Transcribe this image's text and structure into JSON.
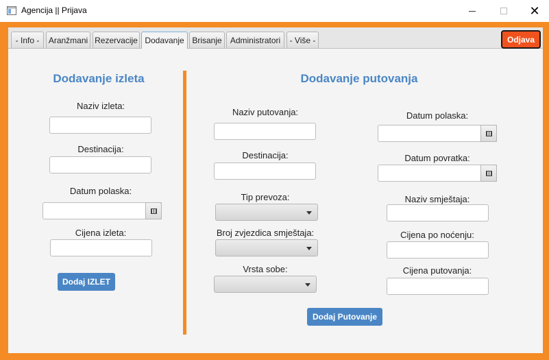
{
  "window": {
    "title": "Agencija || Prijava",
    "minimize_icon": "minimize-icon",
    "maximize_icon": "maximize-icon",
    "close_glyph": "✕"
  },
  "tabs": [
    {
      "label": "- Info -"
    },
    {
      "label": "Aranžmani"
    },
    {
      "label": "Rezervacije"
    },
    {
      "label": "Dodavanje",
      "active": true
    },
    {
      "label": "Brisanje"
    },
    {
      "label": "Administratori"
    },
    {
      "label": "- Više -"
    }
  ],
  "logout_label": "Odjava",
  "izlet": {
    "heading": "Dodavanje izleta",
    "naziv_label": "Naziv izleta:",
    "destinacija_label": "Destinacija:",
    "datum_label": "Datum polaska:",
    "cijena_label": "Cijena izleta:",
    "button": "Dodaj IZLET"
  },
  "putovanje": {
    "heading": "Dodavanje putovanja",
    "naziv_label": "Naziv putovanja:",
    "destinacija_label": "Destinacija:",
    "tip_prevoza_label": "Tip prevoza:",
    "broj_zvjezdica_label": "Broj zvjezdica smještaja:",
    "vrsta_sobe_label": "Vrsta sobe:",
    "datum_polaska_label": "Datum polaska:",
    "datum_povratka_label": "Datum povratka:",
    "naziv_smjestaja_label": "Naziv smještaja:",
    "cijena_nocenje_label": "Cijena po noćenju:",
    "cijena_putovanja_label": "Cijena putovanja:",
    "button": "Dodaj Putovanje"
  },
  "colors": {
    "accent": "#f58b24",
    "heading": "#4a86c5",
    "logout": "#f0521e",
    "button": "#4a86c5"
  }
}
